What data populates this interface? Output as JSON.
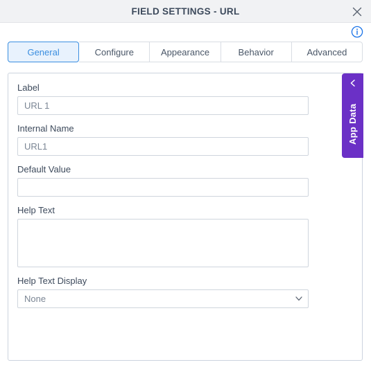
{
  "window": {
    "title": "FIELD SETTINGS - URL",
    "close_icon": "close-icon",
    "info_icon": "info-icon"
  },
  "tabs": {
    "items": [
      {
        "label": "General",
        "active": true
      },
      {
        "label": "Configure",
        "active": false
      },
      {
        "label": "Appearance",
        "active": false
      },
      {
        "label": "Behavior",
        "active": false
      },
      {
        "label": "Advanced",
        "active": false
      }
    ]
  },
  "form": {
    "label_field": {
      "label": "Label",
      "value": "URL 1",
      "placeholder": ""
    },
    "internal_name_field": {
      "label": "Internal Name",
      "value": "URL1",
      "placeholder": ""
    },
    "default_value_field": {
      "label": "Default Value",
      "value": "",
      "placeholder": ""
    },
    "help_text_field": {
      "label": "Help Text",
      "value": "",
      "placeholder": ""
    },
    "help_text_display_field": {
      "label": "Help Text Display",
      "value": "None",
      "options": [
        "None"
      ]
    }
  },
  "side_panel": {
    "label": "App Data",
    "chevron_icon": "chevron-left-icon",
    "color": "#6b30c6"
  },
  "colors": {
    "accent_blue": "#3a8ee0",
    "active_tab_bg": "#e8f2fd",
    "titlebar_bg": "#f1f2f4",
    "label_text": "#3d4a5c",
    "input_text": "#7b8694",
    "border": "#cfd5dd",
    "purple": "#6b30c6"
  }
}
